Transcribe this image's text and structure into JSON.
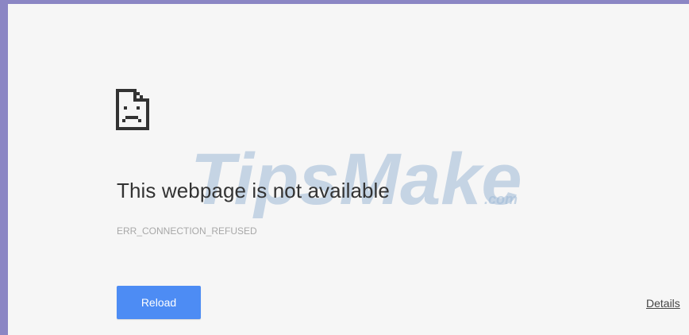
{
  "page": {
    "title": "This webpage is not available",
    "error_code": "ERR_CONNECTION_REFUSED",
    "reload_label": "Reload",
    "details_label": "Details",
    "icon": "sad-page-icon",
    "watermark_text": "TipsMake",
    "watermark_suffix": ".com"
  },
  "colors": {
    "frame_border": "#8b86c4",
    "background": "#f6f6f6",
    "button": "#4d8cf4",
    "title": "#333333",
    "error_code": "#a8a8a8",
    "watermark": "#9db8d6"
  }
}
